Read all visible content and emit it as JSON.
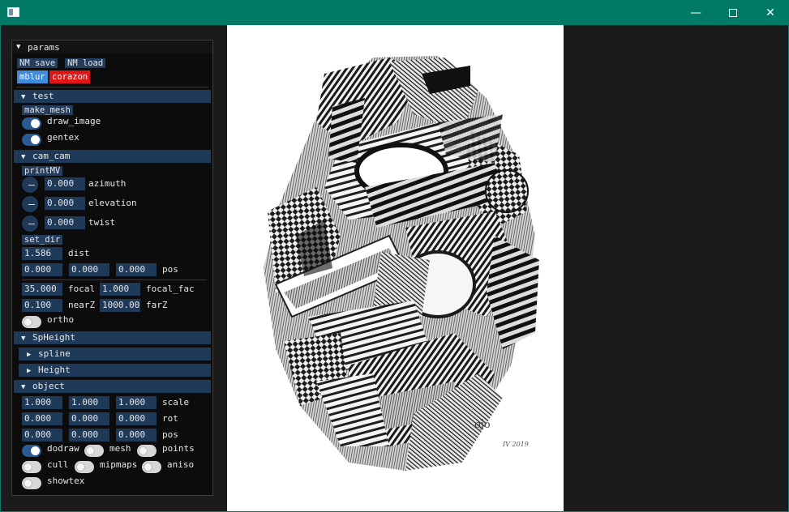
{
  "window": {
    "minimize_glyph": "—",
    "close_glyph": "✕"
  },
  "panel": {
    "title": "params",
    "nm_save": "NM save",
    "nm_load": "NM load",
    "mblur": "mblur",
    "corazon": "corazon"
  },
  "test": {
    "header": "test",
    "make_mesh": "make_mesh",
    "draw_image": {
      "label": "draw_image",
      "on": true
    },
    "gentex": {
      "label": "gentex",
      "on": true
    }
  },
  "cam": {
    "header": "cam_cam",
    "printmv": "printMV",
    "azimuth": {
      "value": "0.000",
      "label": "azimuth"
    },
    "elevation": {
      "value": "0.000",
      "label": "elevation"
    },
    "twist": {
      "value": "0.000",
      "label": "twist"
    },
    "set_dir": "set_dir",
    "dist": {
      "value": "1.586",
      "label": "dist"
    },
    "pos": {
      "x": "0.000",
      "y": "0.000",
      "z": "0.000",
      "label": "pos"
    },
    "focal": {
      "value": "35.000",
      "label": "focal"
    },
    "focal_fac": {
      "value": "1.000",
      "label": "focal_fac"
    },
    "nearz": {
      "value": "0.100",
      "label": "nearZ"
    },
    "farz": {
      "value": "1000.000",
      "label": "farZ"
    },
    "ortho": {
      "label": "ortho",
      "on": false
    }
  },
  "spheight": {
    "header": "SpHeight",
    "spline": "spline",
    "height": "Height"
  },
  "object": {
    "header": "object",
    "scale": {
      "x": "1.000",
      "y": "1.000",
      "z": "1.000",
      "label": "scale"
    },
    "rot": {
      "x": "0.000",
      "y": "0.000",
      "z": "0.000",
      "label": "rot"
    },
    "pos": {
      "x": "0.000",
      "y": "0.000",
      "z": "0.000",
      "label": "pos"
    },
    "dodraw": {
      "label": "dodraw",
      "on": true
    },
    "mesh": {
      "label": "mesh",
      "on": false
    },
    "points": {
      "label": "points",
      "on": false
    },
    "cull": {
      "label": "cull",
      "on": false
    },
    "mipmaps": {
      "label": "mipmaps",
      "on": false
    },
    "aniso": {
      "label": "aniso",
      "on": false
    },
    "showtex": {
      "label": "showtex",
      "on": false
    }
  },
  "artwork": {
    "signature": "oĵo",
    "date_mark": "IV 2019"
  },
  "icons": {
    "expanded": "▼",
    "collapsed": "▶"
  },
  "colors": {
    "titlebar": "#007a66",
    "header": "#1f3958",
    "accent_blue": "#3f8cdc",
    "accent_red": "#e01616"
  }
}
